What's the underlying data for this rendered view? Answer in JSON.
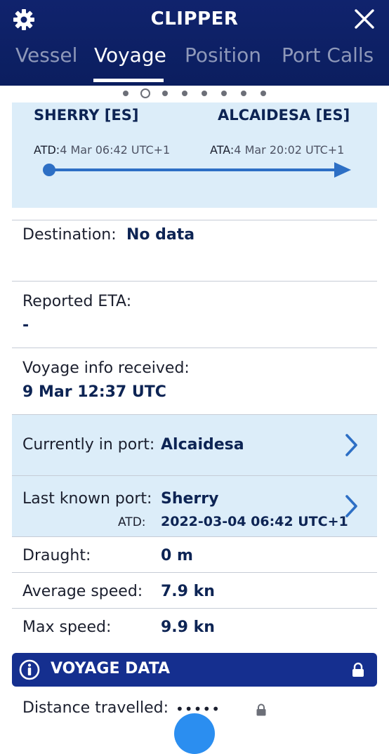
{
  "app": {
    "title": "CLIPPER"
  },
  "tabs": [
    {
      "label": "Vessel"
    },
    {
      "label": "Voyage",
      "active": true
    },
    {
      "label": "Position"
    },
    {
      "label": "Port Calls"
    }
  ],
  "pager": {
    "pages": 8,
    "current": 2
  },
  "route": {
    "from_port": "SHERRY [ES]",
    "to_port": "ALCAIDESA [ES]",
    "atd_label": "ATD:",
    "atd_value": "4 Mar 06:42 UTC+1",
    "ata_label": "ATA:",
    "ata_value": "4 Mar 20:02 UTC+1"
  },
  "destination": {
    "label": "Destination:",
    "value": "No data"
  },
  "reported_eta": {
    "label": "Reported ETA:",
    "value": "-"
  },
  "voyage_info": {
    "label": "Voyage info received:",
    "value": "9 Mar 12:37 UTC"
  },
  "current_port": {
    "label": "Currently in port:",
    "value": "Alcaidesa"
  },
  "last_port": {
    "label": "Last known port:",
    "value": "Sherry",
    "atd_label": "ATD:",
    "atd_value": "2022-03-04 06:42 UTC+1"
  },
  "draught": {
    "label": "Draught:",
    "value": "0 m"
  },
  "avg_speed": {
    "label": "Average speed:",
    "value": "7.9 kn"
  },
  "max_speed": {
    "label": "Max speed:",
    "value": "9.9 kn"
  },
  "voyage_data": {
    "title": "VOYAGE DATA"
  },
  "distance": {
    "label": "Distance travelled:",
    "masked": "•••••"
  },
  "colors": {
    "header": "#10236d",
    "accent": "#2d6fc5",
    "panel": "#dcedf9",
    "section": "#152f8f"
  },
  "icons": [
    "gear-icon",
    "close-icon",
    "chevron-right-icon",
    "info-icon",
    "lock-icon"
  ]
}
